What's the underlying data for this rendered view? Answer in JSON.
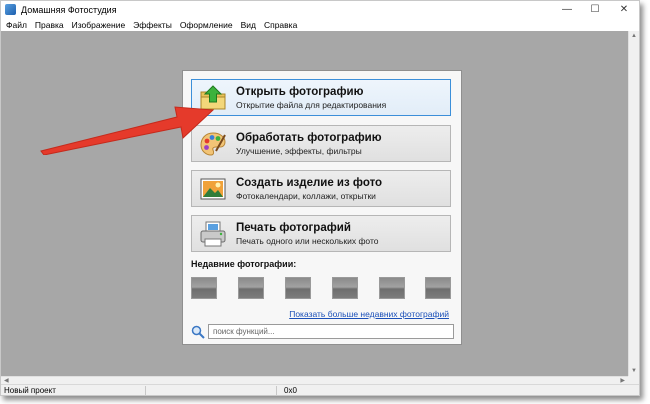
{
  "window": {
    "title": "Домашняя Фотостудия",
    "controls": {
      "minimize": "—",
      "maximize": "☐",
      "close": "✕"
    }
  },
  "menu": {
    "items": [
      "Файл",
      "Правка",
      "Изображение",
      "Эффекты",
      "Оформление",
      "Вид",
      "Справка"
    ]
  },
  "panel": {
    "actions": [
      {
        "title": "Открыть фотографию",
        "subtitle": "Открытие файла для редактирования",
        "icon": "open-folder-icon",
        "selected": true
      },
      {
        "title": "Обработать фотографию",
        "subtitle": "Улучшение, эффекты, фильтры",
        "icon": "palette-icon",
        "selected": false
      },
      {
        "title": "Создать изделие из фото",
        "subtitle": "Фотокалендари, коллажи, открытки",
        "icon": "photo-product-icon",
        "selected": false
      },
      {
        "title": "Печать фотографий",
        "subtitle": "Печать одного или нескольких фото",
        "icon": "printer-icon",
        "selected": false
      }
    ],
    "recent_label": "Недавние фотографии:",
    "recent_count": 6,
    "more_link": "Показать больше недавних фотографий",
    "search": {
      "placeholder": "поиск функций..."
    }
  },
  "status": {
    "project": "Новый проект",
    "coords": "0x0"
  },
  "colors": {
    "workspace": "#a7a7a7",
    "selected_border": "#3c8fd9",
    "link": "#1a4fb8",
    "arrow": "#e53a2b"
  }
}
